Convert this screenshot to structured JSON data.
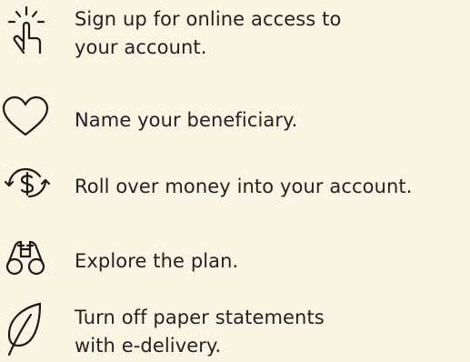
{
  "colors": {
    "background": "#fbf4e2",
    "text": "#222222",
    "icon_stroke": "#1a1a1a"
  },
  "items": [
    {
      "icon": "tap-hand-icon",
      "label_lines": [
        "Sign up for online access to",
        "your account."
      ]
    },
    {
      "icon": "heart-icon",
      "label_lines": [
        "Name your beneficiary."
      ]
    },
    {
      "icon": "rollover-dollar-icon",
      "label_lines": [
        "Roll over money into your account."
      ]
    },
    {
      "icon": "binoculars-icon",
      "label_lines": [
        "Explore the plan."
      ]
    },
    {
      "icon": "leaf-icon",
      "label_lines": [
        "Turn off paper statements",
        "with e-delivery."
      ]
    }
  ]
}
